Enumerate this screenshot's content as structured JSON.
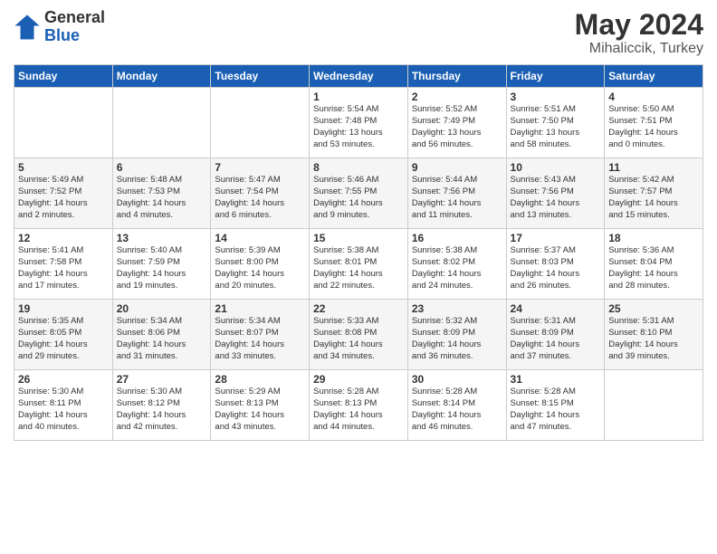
{
  "logo": {
    "general": "General",
    "blue": "Blue"
  },
  "title": "May 2024",
  "subtitle": "Mihaliccik, Turkey",
  "weekdays": [
    "Sunday",
    "Monday",
    "Tuesday",
    "Wednesday",
    "Thursday",
    "Friday",
    "Saturday"
  ],
  "weeks": [
    [
      {
        "day": "",
        "info": ""
      },
      {
        "day": "",
        "info": ""
      },
      {
        "day": "",
        "info": ""
      },
      {
        "day": "1",
        "info": "Sunrise: 5:54 AM\nSunset: 7:48 PM\nDaylight: 13 hours\nand 53 minutes."
      },
      {
        "day": "2",
        "info": "Sunrise: 5:52 AM\nSunset: 7:49 PM\nDaylight: 13 hours\nand 56 minutes."
      },
      {
        "day": "3",
        "info": "Sunrise: 5:51 AM\nSunset: 7:50 PM\nDaylight: 13 hours\nand 58 minutes."
      },
      {
        "day": "4",
        "info": "Sunrise: 5:50 AM\nSunset: 7:51 PM\nDaylight: 14 hours\nand 0 minutes."
      }
    ],
    [
      {
        "day": "5",
        "info": "Sunrise: 5:49 AM\nSunset: 7:52 PM\nDaylight: 14 hours\nand 2 minutes."
      },
      {
        "day": "6",
        "info": "Sunrise: 5:48 AM\nSunset: 7:53 PM\nDaylight: 14 hours\nand 4 minutes."
      },
      {
        "day": "7",
        "info": "Sunrise: 5:47 AM\nSunset: 7:54 PM\nDaylight: 14 hours\nand 6 minutes."
      },
      {
        "day": "8",
        "info": "Sunrise: 5:46 AM\nSunset: 7:55 PM\nDaylight: 14 hours\nand 9 minutes."
      },
      {
        "day": "9",
        "info": "Sunrise: 5:44 AM\nSunset: 7:56 PM\nDaylight: 14 hours\nand 11 minutes."
      },
      {
        "day": "10",
        "info": "Sunrise: 5:43 AM\nSunset: 7:56 PM\nDaylight: 14 hours\nand 13 minutes."
      },
      {
        "day": "11",
        "info": "Sunrise: 5:42 AM\nSunset: 7:57 PM\nDaylight: 14 hours\nand 15 minutes."
      }
    ],
    [
      {
        "day": "12",
        "info": "Sunrise: 5:41 AM\nSunset: 7:58 PM\nDaylight: 14 hours\nand 17 minutes."
      },
      {
        "day": "13",
        "info": "Sunrise: 5:40 AM\nSunset: 7:59 PM\nDaylight: 14 hours\nand 19 minutes."
      },
      {
        "day": "14",
        "info": "Sunrise: 5:39 AM\nSunset: 8:00 PM\nDaylight: 14 hours\nand 20 minutes."
      },
      {
        "day": "15",
        "info": "Sunrise: 5:38 AM\nSunset: 8:01 PM\nDaylight: 14 hours\nand 22 minutes."
      },
      {
        "day": "16",
        "info": "Sunrise: 5:38 AM\nSunset: 8:02 PM\nDaylight: 14 hours\nand 24 minutes."
      },
      {
        "day": "17",
        "info": "Sunrise: 5:37 AM\nSunset: 8:03 PM\nDaylight: 14 hours\nand 26 minutes."
      },
      {
        "day": "18",
        "info": "Sunrise: 5:36 AM\nSunset: 8:04 PM\nDaylight: 14 hours\nand 28 minutes."
      }
    ],
    [
      {
        "day": "19",
        "info": "Sunrise: 5:35 AM\nSunset: 8:05 PM\nDaylight: 14 hours\nand 29 minutes."
      },
      {
        "day": "20",
        "info": "Sunrise: 5:34 AM\nSunset: 8:06 PM\nDaylight: 14 hours\nand 31 minutes."
      },
      {
        "day": "21",
        "info": "Sunrise: 5:34 AM\nSunset: 8:07 PM\nDaylight: 14 hours\nand 33 minutes."
      },
      {
        "day": "22",
        "info": "Sunrise: 5:33 AM\nSunset: 8:08 PM\nDaylight: 14 hours\nand 34 minutes."
      },
      {
        "day": "23",
        "info": "Sunrise: 5:32 AM\nSunset: 8:09 PM\nDaylight: 14 hours\nand 36 minutes."
      },
      {
        "day": "24",
        "info": "Sunrise: 5:31 AM\nSunset: 8:09 PM\nDaylight: 14 hours\nand 37 minutes."
      },
      {
        "day": "25",
        "info": "Sunrise: 5:31 AM\nSunset: 8:10 PM\nDaylight: 14 hours\nand 39 minutes."
      }
    ],
    [
      {
        "day": "26",
        "info": "Sunrise: 5:30 AM\nSunset: 8:11 PM\nDaylight: 14 hours\nand 40 minutes."
      },
      {
        "day": "27",
        "info": "Sunrise: 5:30 AM\nSunset: 8:12 PM\nDaylight: 14 hours\nand 42 minutes."
      },
      {
        "day": "28",
        "info": "Sunrise: 5:29 AM\nSunset: 8:13 PM\nDaylight: 14 hours\nand 43 minutes."
      },
      {
        "day": "29",
        "info": "Sunrise: 5:28 AM\nSunset: 8:13 PM\nDaylight: 14 hours\nand 44 minutes."
      },
      {
        "day": "30",
        "info": "Sunrise: 5:28 AM\nSunset: 8:14 PM\nDaylight: 14 hours\nand 46 minutes."
      },
      {
        "day": "31",
        "info": "Sunrise: 5:28 AM\nSunset: 8:15 PM\nDaylight: 14 hours\nand 47 minutes."
      },
      {
        "day": "",
        "info": ""
      }
    ]
  ]
}
